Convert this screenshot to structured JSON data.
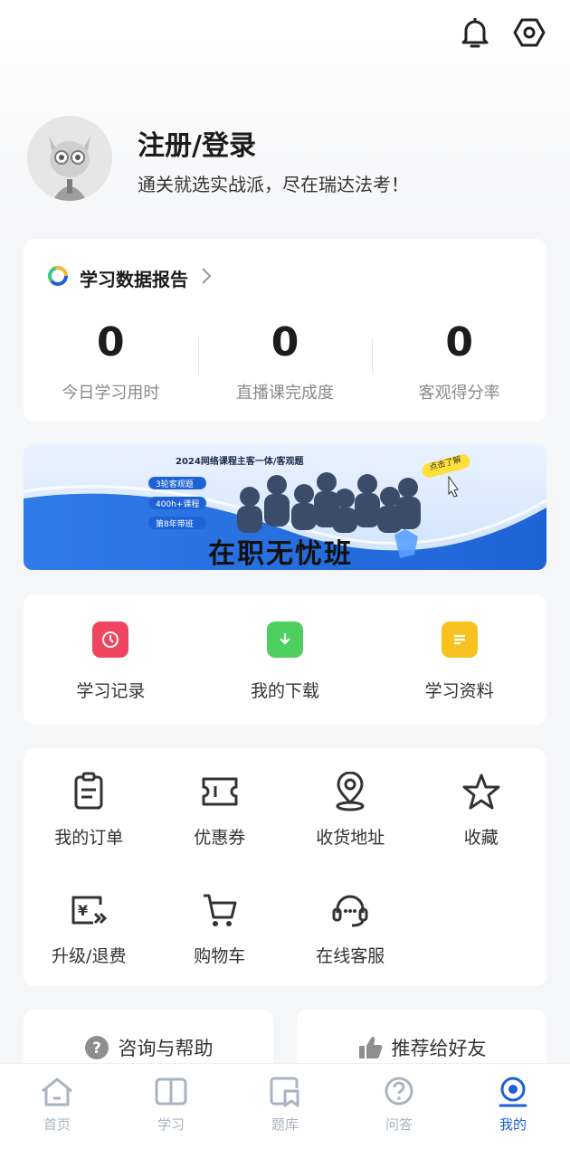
{
  "header": {
    "bell_icon": "bell-icon",
    "settings_icon": "hexagon-settings-icon"
  },
  "profile": {
    "login_label": "注册/登录",
    "slogan": "通关就选实战派，尽在瑞达法考！"
  },
  "report": {
    "title": "学习数据报告",
    "stats": [
      {
        "value": "0",
        "label": "今日学习用时"
      },
      {
        "value": "0",
        "label": "直播课完成度"
      },
      {
        "value": "0",
        "label": "客观得分率"
      }
    ]
  },
  "banner": {
    "top_text": "2024网络课程主客一体/客观题",
    "badges": [
      "3轮客观题",
      "400h+课程",
      "第8年带班"
    ],
    "main_text": "在职无忧班",
    "cta": "点击了解"
  },
  "tools": [
    {
      "label": "学习记录",
      "icon": "clock-icon",
      "color": "#f0455f"
    },
    {
      "label": "我的下载",
      "icon": "download-icon",
      "color": "#4ccf5e"
    },
    {
      "label": "学习资料",
      "icon": "document-icon",
      "color": "#f7c21d"
    }
  ],
  "services": [
    {
      "label": "我的订单",
      "icon": "order-icon"
    },
    {
      "label": "优惠券",
      "icon": "coupon-icon"
    },
    {
      "label": "收货地址",
      "icon": "location-icon"
    },
    {
      "label": "收藏",
      "icon": "star-icon"
    },
    {
      "label": "升级/退费",
      "icon": "refund-icon"
    },
    {
      "label": "购物车",
      "icon": "cart-icon"
    },
    {
      "label": "在线客服",
      "icon": "headset-icon"
    }
  ],
  "bottom": {
    "help_label": "咨询与帮助",
    "recommend_label": "推荐给好友"
  },
  "tabbar": [
    {
      "label": "首页",
      "icon": "home-icon",
      "active": false
    },
    {
      "label": "学习",
      "icon": "book-icon",
      "active": false
    },
    {
      "label": "题库",
      "icon": "question-bank-icon",
      "active": false
    },
    {
      "label": "问答",
      "icon": "qa-icon",
      "active": false
    },
    {
      "label": "我的",
      "icon": "profile-icon",
      "active": true
    }
  ],
  "colors": {
    "accent": "#1f5fd6",
    "tab_inactive": "#a9b3c2"
  }
}
